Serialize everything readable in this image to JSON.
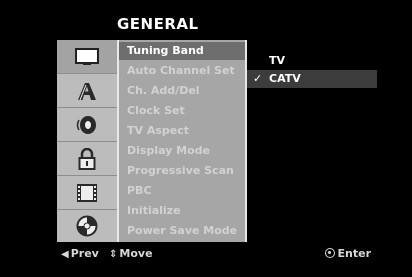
{
  "header": {
    "title": "GENERAL"
  },
  "sidebar_icons": [
    {
      "name": "display-icon",
      "active": true
    },
    {
      "name": "language-icon",
      "active": false
    },
    {
      "name": "audio-speaker-icon",
      "active": false
    },
    {
      "name": "lock-icon",
      "active": false
    },
    {
      "name": "film-icon",
      "active": false
    },
    {
      "name": "disc-icon",
      "active": false
    }
  ],
  "menu": {
    "items": [
      "Tuning Band",
      "Auto Channel Set",
      "Ch. Add/Del",
      "Clock Set",
      "TV Aspect",
      "Display Mode",
      "Progressive Scan",
      "PBC",
      "Initialize",
      "Power Save Mode"
    ],
    "active_index": 0
  },
  "options": {
    "items": [
      "TV",
      "CATV"
    ],
    "selected_index": 1,
    "check_glyph": "✓"
  },
  "footer": {
    "prev_label": "Prev",
    "prev_glyph": "◀",
    "move_label": "Move",
    "move_glyph": "⇕",
    "enter_label": "Enter"
  },
  "colors": {
    "panel": "#b8b8b8",
    "menu_active": "#6e6e6e",
    "option_selected": "#3c3c3c",
    "text_dim": "#d2d2d2"
  }
}
